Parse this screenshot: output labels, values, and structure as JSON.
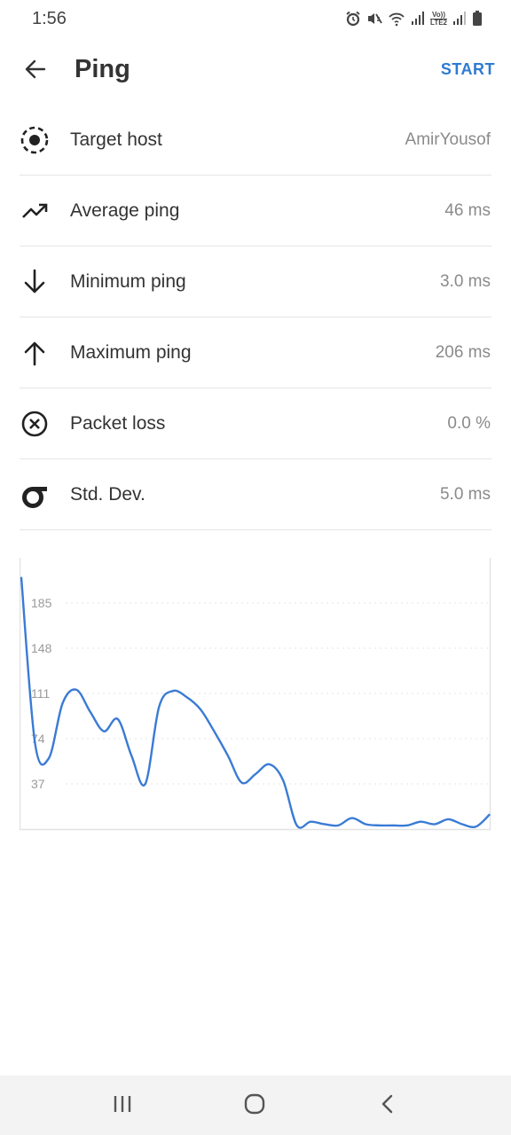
{
  "status_bar": {
    "time": "1:56",
    "icons": [
      "alarm-icon",
      "mute-icon",
      "wifi-icon",
      "signal-icon",
      "volte-lte2-icon",
      "signal-icon",
      "battery-icon"
    ],
    "volte_top": "Vo))",
    "volte_bottom": "LTE2"
  },
  "app_bar": {
    "title": "Ping",
    "action": "START",
    "accent_color": "#2f7bd1"
  },
  "rows": [
    {
      "label": "Target host",
      "value": "AmirYousof",
      "icon": "target-icon"
    },
    {
      "label": "Average ping",
      "value": "46 ms",
      "icon": "trending-up-icon"
    },
    {
      "label": "Minimum ping",
      "value": "3.0 ms",
      "icon": "arrow-down-icon"
    },
    {
      "label": "Maximum ping",
      "value": "206 ms",
      "icon": "arrow-up-icon"
    },
    {
      "label": "Packet loss",
      "value": "0.0 %",
      "icon": "cancel-circle-icon"
    },
    {
      "label": "Std. Dev.",
      "value": "5.0 ms",
      "icon": "sigma-icon"
    }
  ],
  "chart_data": {
    "type": "line",
    "yticks": [
      37,
      74,
      111,
      148,
      185
    ],
    "ylim": [
      0,
      206
    ],
    "line_color": "#3a7bd5",
    "series": [
      {
        "values": [
          206,
          70,
          58,
          103,
          114,
          96,
          80,
          90,
          60,
          37,
          100,
          113,
          108,
          98,
          80,
          60,
          38,
          45,
          53,
          40,
          3,
          6,
          4,
          3,
          9,
          4,
          3,
          3,
          3,
          6,
          4,
          8,
          4,
          2,
          12
        ]
      }
    ]
  },
  "nav_bar": {
    "buttons": [
      "recent-apps-icon",
      "home-icon",
      "back-icon"
    ]
  }
}
